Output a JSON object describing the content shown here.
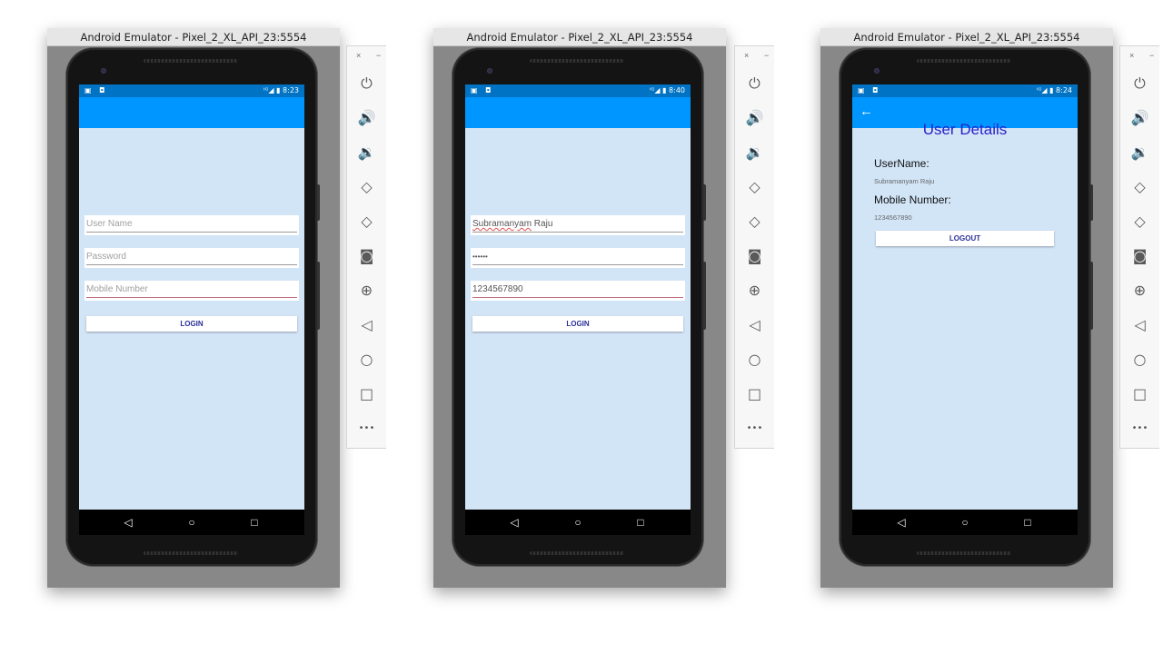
{
  "emulators": [
    {
      "window_title": "Android Emulator - Pixel_2_XL_API_23:5554",
      "status": {
        "time": "8:23",
        "left_icons": "▣ ◘",
        "signal": "ᴵᴳ◢ ▮"
      },
      "login": {
        "username_placeholder": "User Name",
        "password_placeholder": "Password",
        "mobile_placeholder": "Mobile Number",
        "login_label": "LOGIN"
      }
    },
    {
      "window_title": "Android Emulator - Pixel_2_XL_API_23:5554",
      "status": {
        "time": "8:40",
        "left_icons": "▣ ◘",
        "signal": "ᴵᴳ◢ ▮"
      },
      "login": {
        "username_first": "Subramanyam",
        "username_rest": " Raju",
        "password_value": "••••••",
        "mobile_value": "1234567890",
        "login_label": "LOGIN"
      }
    },
    {
      "window_title": "Android Emulator - Pixel_2_XL_API_23:5554",
      "status": {
        "time": "8:24",
        "left_icons": "▣ ◘",
        "signal": "ᴵᴳ◢ ▮"
      },
      "details": {
        "back_icon": "←",
        "title": "User Details",
        "username_label": "UserName:",
        "username_value": "Subramanyam Raju",
        "mobile_label": "Mobile Number:",
        "mobile_value": "1234567890",
        "logout_label": "LOGOUT"
      }
    }
  ],
  "nav": {
    "back": "◁",
    "home": "○",
    "recents": "□"
  },
  "toolbar": {
    "close": "×",
    "minimize": "−",
    "icons": [
      "power-icon",
      "volume-up-icon",
      "volume-down-icon",
      "rotate-left-icon",
      "rotate-right-icon",
      "camera-icon",
      "zoom-icon",
      "back-icon",
      "home-icon",
      "overview-icon",
      "more-icon"
    ],
    "glyphs": [
      "⏻",
      "🔊",
      "🔉",
      "◇",
      "◇",
      "◙",
      "⊕",
      "◁",
      "○",
      "□",
      "•••"
    ]
  }
}
